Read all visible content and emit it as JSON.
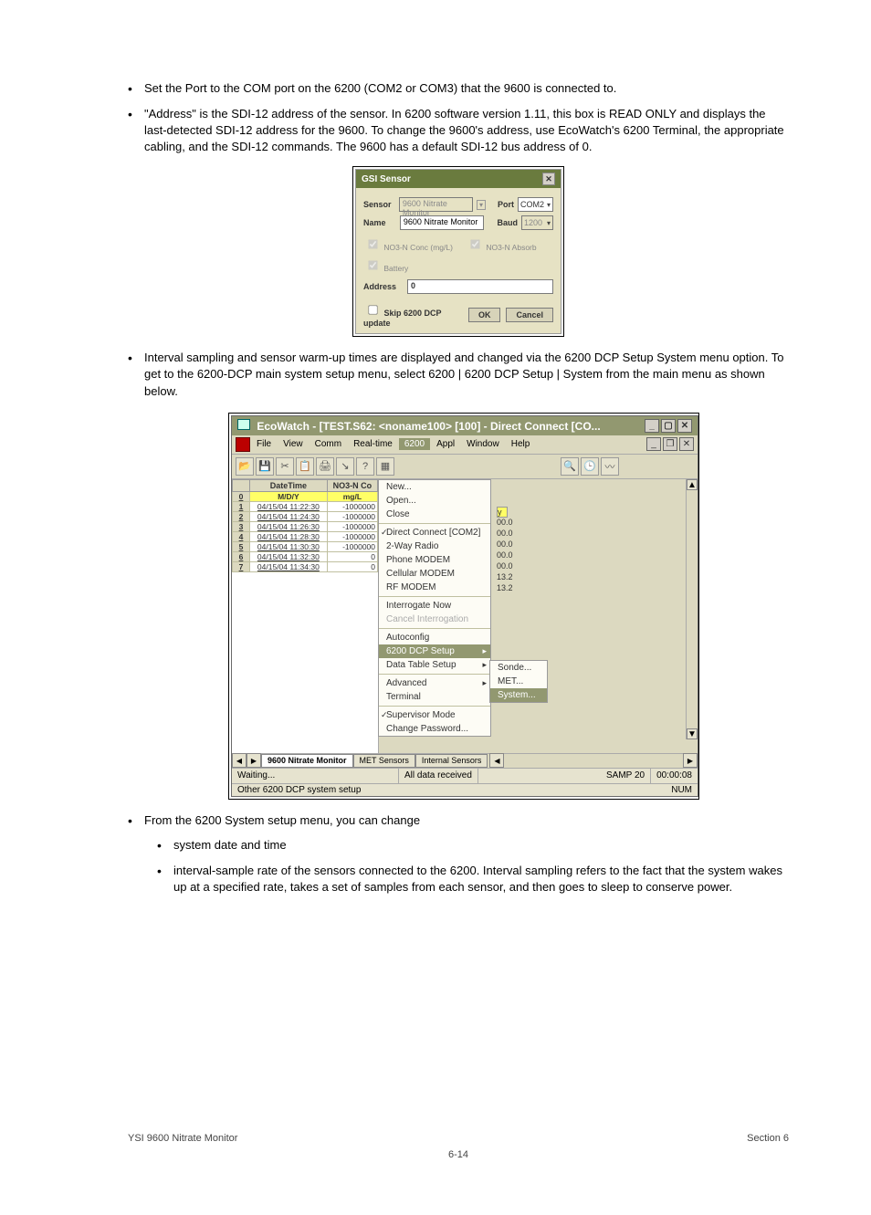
{
  "bullets": {
    "top1": "Set the Port to the COM port on the 6200 (COM2 or COM3) that the 9600 is connected to.",
    "top2": "\"Address\" is the SDI-12 address of the sensor. In 6200 software version 1.11, this box is READ ONLY and displays the last-detected SDI-12 address for the 9600. To change the 9600's address, use EcoWatch's 6200 Terminal, the appropriate cabling, and the SDI-12 commands. The 9600 has a default SDI-12 bus address of 0.",
    "mid1": "Interval sampling and sensor warm-up times are displayed and changed via the 6200 DCP Setup System menu option. To get to the 6200-DCP main system setup menu, select 6200 | 6200 DCP Setup | System from the main menu as shown below.",
    "bottom1": "From the 6200 System setup menu, you can change",
    "sub1": "system date and time",
    "sub2": "interval-sample rate of the sensors connected to the 6200. Interval sampling refers to the fact that the system wakes up at a specified rate, takes a set of samples from each sensor, and then goes to sleep to conserve power."
  },
  "gsi": {
    "title": "GSI Sensor",
    "sensor_label": "Sensor",
    "sensor_value": "9600 Nitrate Monitor",
    "name_label": "Name",
    "name_value": "9600 Nitrate Monitor",
    "port_label": "Port",
    "port_value": "COM2",
    "baud_label": "Baud",
    "baud_value": "1200",
    "chk1": "NO3-N Conc (mg/L)",
    "chk2": "Battery",
    "chk3": "NO3-N Absorb",
    "address_label": "Address",
    "address_value": "0",
    "skip_label": "Skip 6200 DCP update",
    "ok": "OK",
    "cancel": "Cancel"
  },
  "eco": {
    "title": "EcoWatch - [TEST.S62: <noname100> [100] - Direct Connect [CO...",
    "menus": {
      "file": "File",
      "view": "View",
      "comm": "Comm",
      "realtime": "Real-time",
      "m6200": "6200",
      "appl": "Appl",
      "window": "Window",
      "help": "Help"
    },
    "menu6200": {
      "new": "New...",
      "open": "Open...",
      "close": "Close",
      "direct": "Direct Connect [COM2]",
      "twoway": "2-Way Radio",
      "phone": "Phone MODEM",
      "cell": "Cellular MODEM",
      "rf": "RF MODEM",
      "inter": "Interrogate Now",
      "cancelint": "Cancel Interrogation",
      "autoconfig": "Autoconfig",
      "dcp": "6200 DCP Setup",
      "dtable": "Data Table Setup",
      "advanced": "Advanced",
      "terminal": "Terminal",
      "supervisor": "Supervisor Mode",
      "changepw": "Change Password..."
    },
    "submenu": {
      "sonde": "Sonde...",
      "met": "MET...",
      "system": "System..."
    },
    "table": {
      "dt_header": "DateTime",
      "col2": "NO3-N Co",
      "mdy": "M/D/Y",
      "mgl": "mg/L",
      "rows": [
        {
          "i": "0",
          "dt": "",
          "v": ""
        },
        {
          "i": "1",
          "dt": "04/15/04 11:22:30",
          "v": "-1000000"
        },
        {
          "i": "2",
          "dt": "04/15/04 11:24:30",
          "v": "-1000000"
        },
        {
          "i": "3",
          "dt": "04/15/04 11:26:30",
          "v": "-1000000"
        },
        {
          "i": "4",
          "dt": "04/15/04 11:28:30",
          "v": "-1000000"
        },
        {
          "i": "5",
          "dt": "04/15/04 11:30:30",
          "v": "-1000000"
        },
        {
          "i": "6",
          "dt": "04/15/04 11:32:30",
          "v": "0"
        },
        {
          "i": "7",
          "dt": "04/15/04 11:34:30",
          "v": "0"
        }
      ]
    },
    "extra_col_header": "y",
    "extra": [
      "00.0",
      "00.0",
      "00.0",
      "00.0",
      "00.0",
      "13.2",
      "13.2"
    ],
    "tabs": {
      "t1": "9600 Nitrate Monitor",
      "t2": "MET Sensors",
      "t3": "Internal Sensors"
    },
    "status1": {
      "waiting": "Waiting...",
      "all": "All data received",
      "samp": "SAMP 20",
      "time": "00:00:08"
    },
    "status2": {
      "left": "Other 6200 DCP system setup",
      "num": "NUM"
    }
  },
  "footer": {
    "doc": "YSI 9600 Nitrate Monitor",
    "sect": "Section 6",
    "page": "6-14"
  }
}
